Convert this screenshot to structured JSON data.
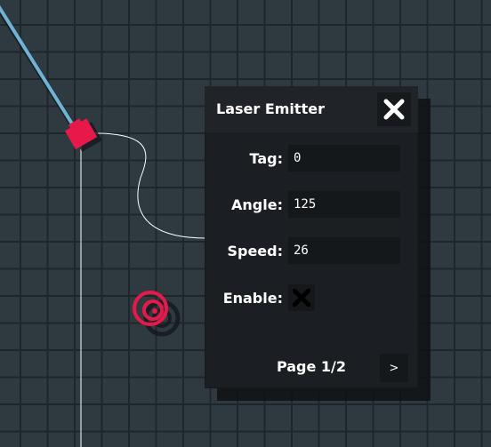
{
  "panel": {
    "title": "Laser Emitter",
    "close_icon": "close-x-icon",
    "fields": {
      "tag": {
        "label": "Tag:",
        "value": "0"
      },
      "angle": {
        "label": "Angle:",
        "value": "125"
      },
      "speed": {
        "label": "Speed:",
        "value": "26"
      }
    },
    "enable": {
      "label": "Enable:",
      "checked": false,
      "icon": "x-mark-icon"
    },
    "pagination": {
      "text": "Page 1/2",
      "next_label": ">"
    }
  },
  "colors": {
    "grid_background": "#2f3a40",
    "grid_lines": "#1e262b",
    "panel_bg": "#1b1f23",
    "header_bg": "#202429",
    "field_bg": "#15181b",
    "laser_beam": "#6fb3d6",
    "emitter": "#e8194a",
    "text": "#ffffff"
  }
}
